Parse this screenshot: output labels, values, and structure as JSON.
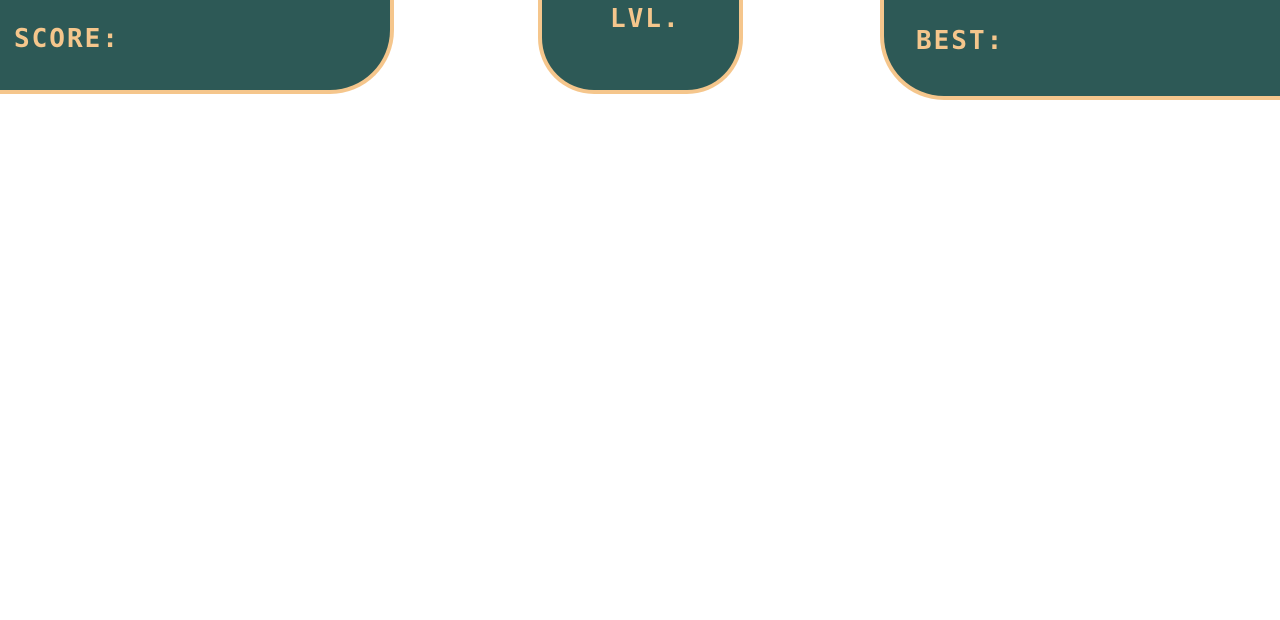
{
  "hud": {
    "score": {
      "label": "SCORE:",
      "value": ""
    },
    "level": {
      "label": "LVL.",
      "value": ""
    },
    "best": {
      "label": "BEST:",
      "value": ""
    }
  },
  "colors": {
    "panel_bg": "#2d5956",
    "accent": "#f5c68c",
    "page_bg": "#ffffff"
  }
}
